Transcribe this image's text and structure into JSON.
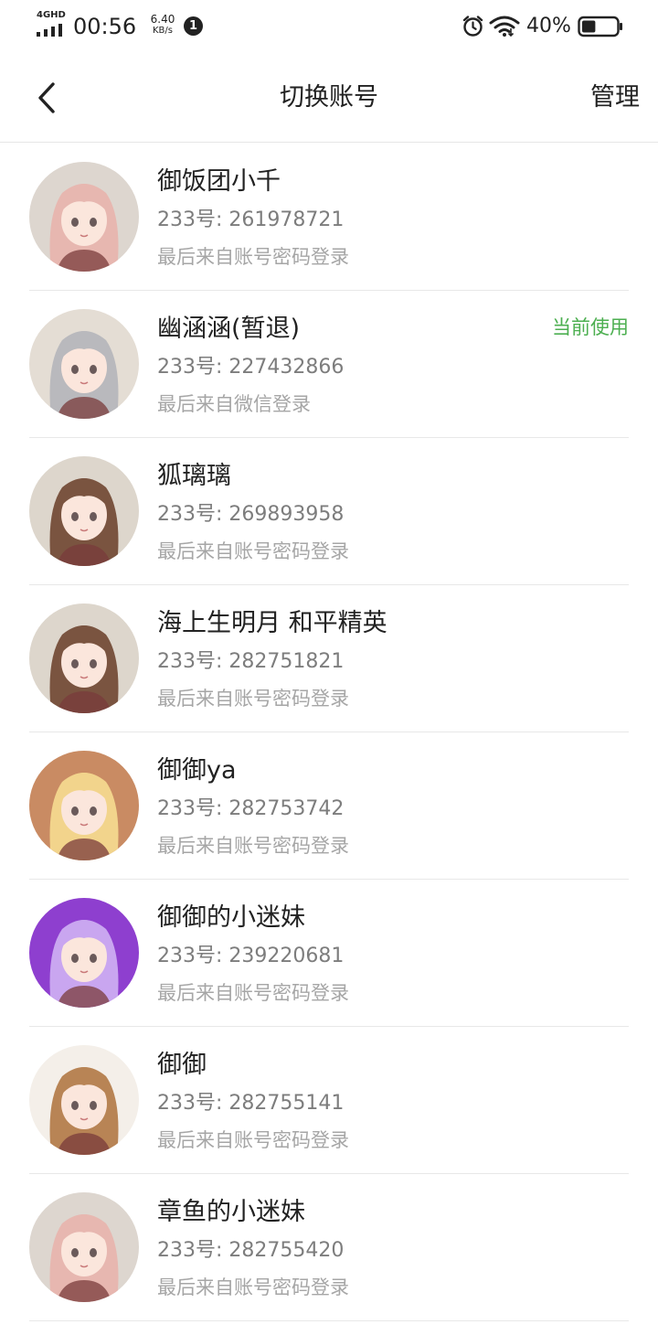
{
  "status_bar": {
    "network": "4GHD",
    "time": "00:56",
    "speed_value": "6.40",
    "speed_unit": "KB/s",
    "notification_count": "1",
    "battery_percent": "40%",
    "battery_level": 0.4
  },
  "nav": {
    "title": "切换账号",
    "manage_label": "管理"
  },
  "accounts": [
    {
      "name": "御饭团小千",
      "id": "233号: 261978721",
      "login_method": "最后来自账号密码登录",
      "current_label": "",
      "avatar_bg": "#ddd6cf",
      "hair_color": "#e7b7b0"
    },
    {
      "name": "幽涵涵(暂退)",
      "id": "233号: 227432866",
      "login_method": "最后来自微信登录",
      "current_label": "当前使用",
      "avatar_bg": "#e4ddd4",
      "hair_color": "#b9b9bd"
    },
    {
      "name": "狐璃璃",
      "id": "233号: 269893958",
      "login_method": "最后来自账号密码登录",
      "current_label": "",
      "avatar_bg": "#ddd6cc",
      "hair_color": "#7a5440"
    },
    {
      "name": "海上生明月 和平精英",
      "id": "233号: 282751821",
      "login_method": "最后来自账号密码登录",
      "current_label": "",
      "avatar_bg": "#ddd6cc",
      "hair_color": "#7a5440"
    },
    {
      "name": "御御ya",
      "id": "233号: 282753742",
      "login_method": "最后来自账号密码登录",
      "current_label": "",
      "avatar_bg": "#c98b63",
      "hair_color": "#f2d48c"
    },
    {
      "name": "御御的小迷妹",
      "id": "233号: 239220681",
      "login_method": "最后来自账号密码登录",
      "current_label": "",
      "avatar_bg": "#8e3fcf",
      "hair_color": "#c9a6f0"
    },
    {
      "name": "御御",
      "id": "233号: 282755141",
      "login_method": "最后来自账号密码登录",
      "current_label": "",
      "avatar_bg": "#f4efe9",
      "hair_color": "#b88455"
    },
    {
      "name": "章鱼的小迷妹",
      "id": "233号: 282755420",
      "login_method": "最后来自账号密码登录",
      "current_label": "",
      "avatar_bg": "#ddd6cf",
      "hair_color": "#e7b7b0"
    }
  ]
}
